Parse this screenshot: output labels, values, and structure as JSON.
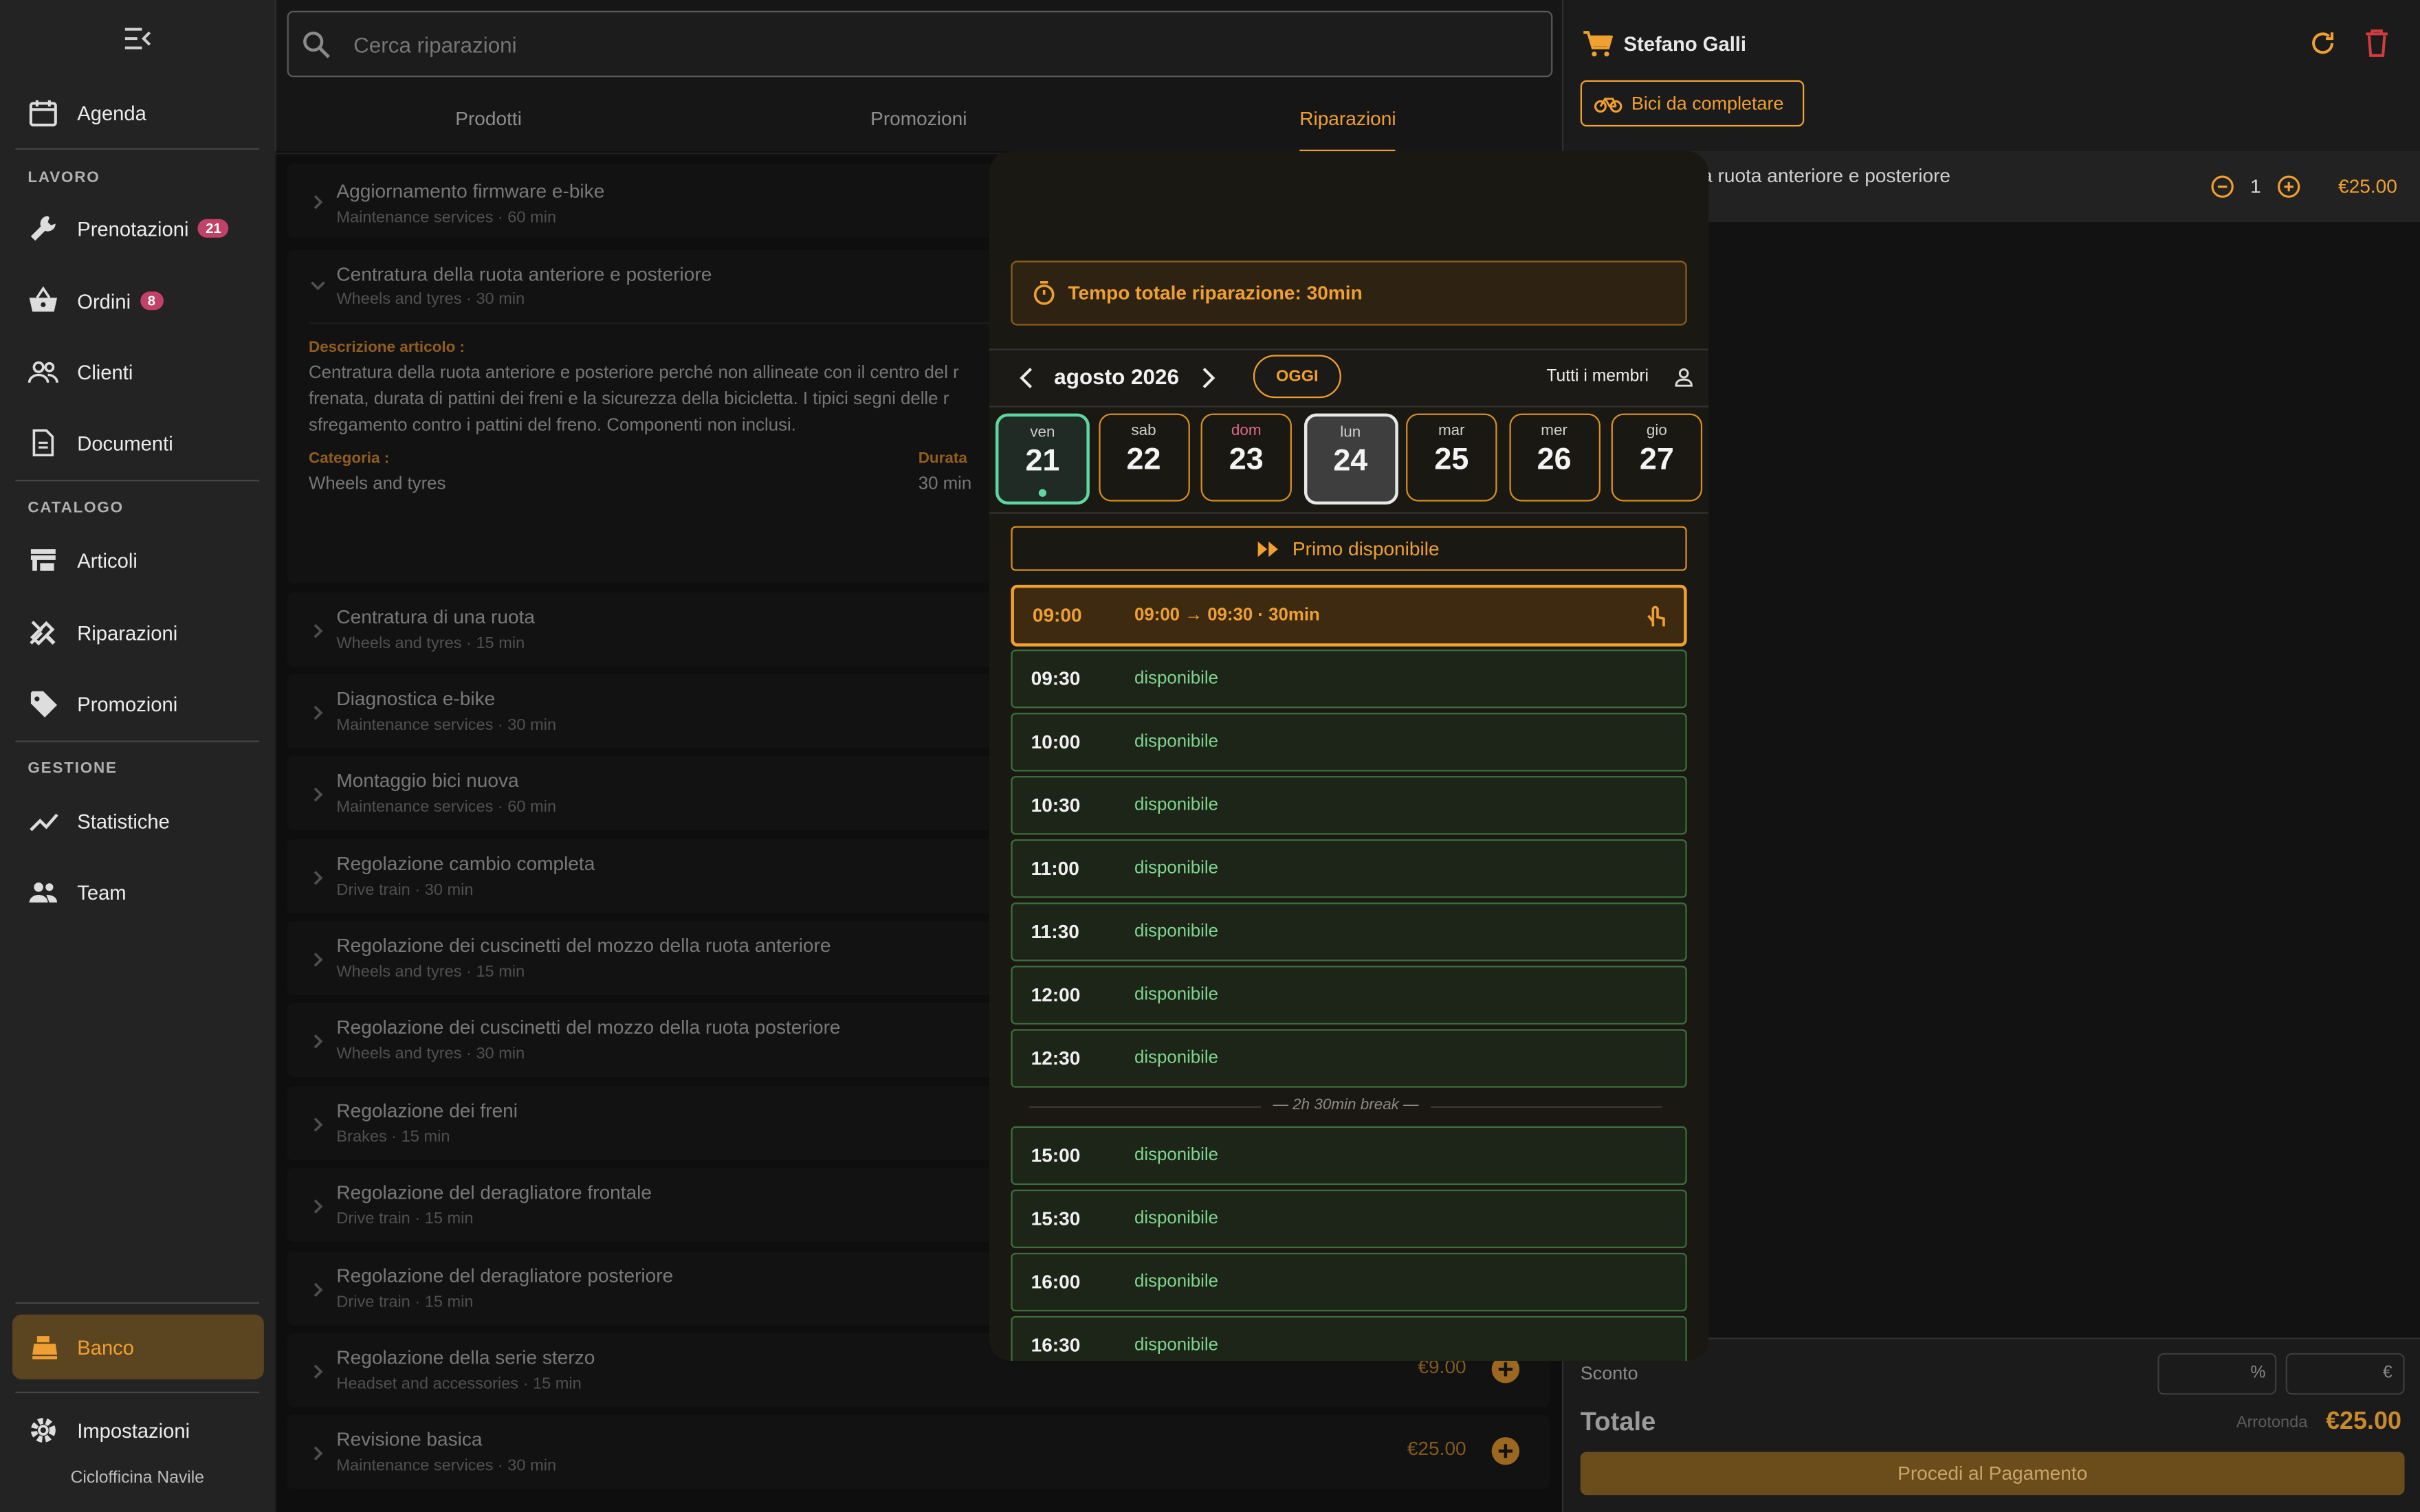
{
  "sidebar": {
    "agenda": "Agenda",
    "sec_lavoro": "LAVORO",
    "prenotazioni": "Prenotazioni",
    "prenotazioni_badge": "21",
    "ordini": "Ordini",
    "ordini_badge": "8",
    "clienti": "Clienti",
    "documenti": "Documenti",
    "sec_catalogo": "CATALOGO",
    "articoli": "Articoli",
    "riparazioni": "Riparazioni",
    "promozioni": "Promozioni",
    "sec_gestione": "GESTIONE",
    "statistiche": "Statistiche",
    "team": "Team",
    "banco": "Banco",
    "impostazioni": "Impostazioni",
    "shop_name": "Ciclofficina Navile"
  },
  "search": {
    "placeholder": "Cerca riparazioni"
  },
  "tabs": [
    "Prodotti",
    "Promozioni",
    "Riparazioni"
  ],
  "active_tab": "Riparazioni",
  "expanded": {
    "title": "Centratura della ruota anteriore e posteriore",
    "subtitle": "Wheels and tyres · 30 min",
    "desc_label": "Descrizione articolo :",
    "desc_line1": "Centratura della ruota anteriore e posteriore perché non allineate con il centro del r",
    "desc_line2": "frenata, durata di pattini dei freni e la sicurezza della bicicletta. I tipici segni delle r",
    "desc_line3": "sfregamento contro i pattini del freno. Componenti non inclusi.",
    "cat_label": "Categoria :",
    "cat_value": "Wheels and tyres",
    "dur_label": "Durata",
    "dur_value": "30 min"
  },
  "first_item": {
    "title": "Aggiornamento firmware e-bike",
    "subtitle": "Maintenance services · 60 min"
  },
  "repairs": [
    {
      "title": "Centratura di una ruota",
      "subtitle": "Wheels and tyres · 15 min"
    },
    {
      "title": "Diagnostica e-bike",
      "subtitle": "Maintenance services · 30 min"
    },
    {
      "title": "Montaggio bici nuova",
      "subtitle": "Maintenance services · 60 min"
    },
    {
      "title": "Regolazione cambio completa",
      "subtitle": "Drive train · 30 min"
    },
    {
      "title": "Regolazione dei cuscinetti del mozzo della ruota anteriore",
      "subtitle": "Wheels and tyres · 15 min"
    },
    {
      "title": "Regolazione dei cuscinetti del mozzo della ruota posteriore",
      "subtitle": "Wheels and tyres · 30 min"
    },
    {
      "title": "Regolazione dei freni",
      "subtitle": "Brakes · 15 min"
    },
    {
      "title": "Regolazione del deragliatore frontale",
      "subtitle": "Drive train · 15 min"
    },
    {
      "title": "Regolazione del deragliatore posteriore",
      "subtitle": "Drive train · 15 min"
    },
    {
      "title": "Regolazione della serie sterzo",
      "subtitle": "Headset and accessories · 15 min",
      "price": "€9.00"
    },
    {
      "title": "Revisione basica",
      "subtitle": "Maintenance services · 30 min",
      "price": "€25.00"
    }
  ],
  "dialog": {
    "total_time": "Tempo totale riparazione: 30min",
    "month": "agosto 2026",
    "today_btn": "OGGI",
    "members": "Tutti i membri",
    "days": [
      {
        "name": "ven",
        "num": "21"
      },
      {
        "name": "sab",
        "num": "22"
      },
      {
        "name": "dom",
        "num": "23"
      },
      {
        "name": "lun",
        "num": "24"
      },
      {
        "name": "mar",
        "num": "25"
      },
      {
        "name": "mer",
        "num": "26"
      },
      {
        "name": "gio",
        "num": "27"
      }
    ],
    "first_available": "Primo disponibile",
    "selected_time": "09:00",
    "selected_range": "09:00 → 09:30 · 30min",
    "slots_a": [
      "09:30",
      "10:00",
      "10:30",
      "11:00",
      "11:30",
      "12:00",
      "12:30"
    ],
    "break_label": "— 2h 30min break —",
    "slots_b": [
      "15:00",
      "15:30",
      "16:00",
      "16:30"
    ],
    "available": "disponibile"
  },
  "cart": {
    "customer": "Stefano Galli",
    "bike_btn": "Bici da completare",
    "item_name": "lla ruota anteriore e posteriore",
    "qty": "1",
    "item_price": "€25.00",
    "discount_label": "Sconto",
    "pct_suffix": "%",
    "eur_suffix": "€",
    "total_label": "Totale",
    "round_label": "Arrotonda",
    "total_value": "€25.00",
    "pay_btn": "Procedi al Pagamento"
  },
  "colors": {
    "accent": "#f0a030",
    "badge": "#c2416a",
    "available_green": "#7fd58f",
    "danger": "#d23c3c"
  }
}
